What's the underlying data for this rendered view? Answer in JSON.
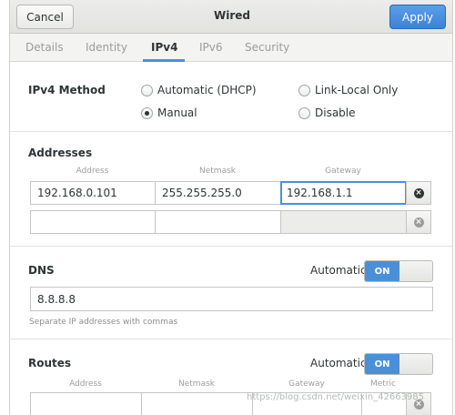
{
  "header": {
    "cancel_label": "Cancel",
    "title": "Wired",
    "apply_label": "Apply"
  },
  "tabs": [
    {
      "label": "Details",
      "active": false
    },
    {
      "label": "Identity",
      "active": false
    },
    {
      "label": "IPv4",
      "active": true
    },
    {
      "label": "IPv6",
      "active": false
    },
    {
      "label": "Security",
      "active": false
    }
  ],
  "method": {
    "label": "IPv4 Method",
    "options": [
      {
        "label": "Automatic (DHCP)",
        "checked": false
      },
      {
        "label": "Link-Local Only",
        "checked": false
      },
      {
        "label": "Manual",
        "checked": true
      },
      {
        "label": "Disable",
        "checked": false
      }
    ]
  },
  "addresses": {
    "label": "Addresses",
    "columns": [
      "Address",
      "Netmask",
      "Gateway"
    ],
    "rows": [
      {
        "address": "192.168.0.101",
        "netmask": "255.255.255.0",
        "gateway": "192.168.1.1"
      },
      {
        "address": "",
        "netmask": "",
        "gateway": ""
      }
    ]
  },
  "dns": {
    "label": "DNS",
    "automatic_label": "Automatic",
    "toggle_label": "ON",
    "value": "8.8.8.8",
    "hint": "Separate IP addresses with commas"
  },
  "routes": {
    "label": "Routes",
    "automatic_label": "Automatic",
    "toggle_label": "ON",
    "columns": [
      "Address",
      "Netmask",
      "Gateway",
      "Metric"
    ]
  },
  "watermark": "https://blog.csdn.net/weixin_42663985",
  "colors": {
    "accent": "#4a90d9",
    "apply": "#3f82d6",
    "delete_active": "#2e3436",
    "delete_inactive": "#9a9e9b"
  }
}
